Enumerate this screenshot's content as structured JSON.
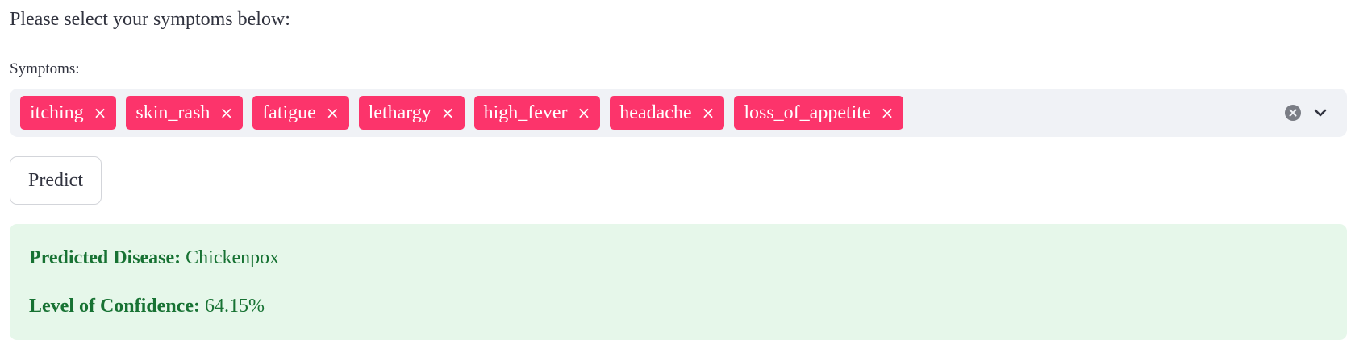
{
  "intro_text": "Please select your symptoms below:",
  "symptoms_field": {
    "label": "Symptoms:",
    "selected": [
      {
        "label": "itching",
        "remove": "×"
      },
      {
        "label": "skin_rash",
        "remove": "×"
      },
      {
        "label": "fatigue",
        "remove": "×"
      },
      {
        "label": "lethargy",
        "remove": "×"
      },
      {
        "label": "high_fever",
        "remove": "×"
      },
      {
        "label": "headache",
        "remove": "×"
      },
      {
        "label": "loss_of_appetite",
        "remove": "×"
      }
    ],
    "clear_icon": "clear-all-icon",
    "dropdown_icon": "chevron-down-icon"
  },
  "predict_button": {
    "label": "Predict"
  },
  "result": {
    "disease_label": "Predicted Disease:",
    "disease_value": "Chickenpox",
    "confidence_label": "Level of Confidence:",
    "confidence_value": "64.15%"
  },
  "colors": {
    "tag_background": "#fc346b",
    "field_background": "#f0f2f6",
    "success_background": "#e6f7ea",
    "success_text": "#177233"
  }
}
